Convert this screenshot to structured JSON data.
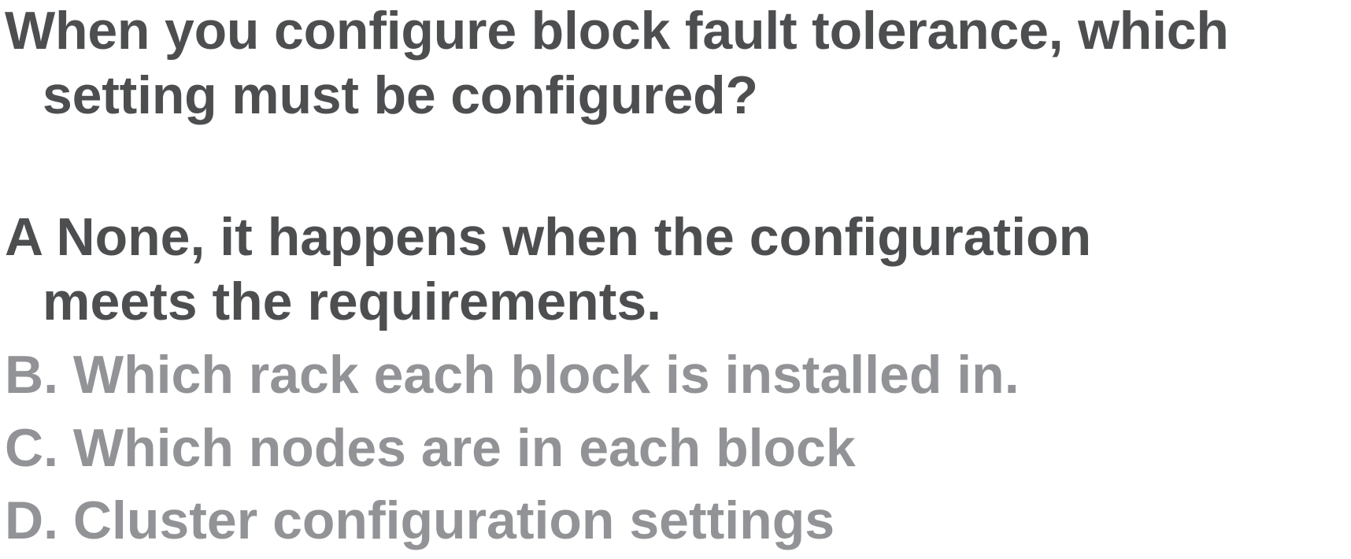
{
  "question": {
    "line1": "When you configure block fault tolerance, which",
    "line2": "setting must be configured?"
  },
  "options": [
    {
      "line1": "A None, it happens when the configuration",
      "line2": "meets the requirements."
    },
    {
      "line1": "B. Which rack each block is installed in."
    },
    {
      "line1": "C. Which nodes are in each block"
    },
    {
      "line1": "D. Cluster configuration settings"
    }
  ],
  "colors": {
    "primary_text": "#4d4e50",
    "muted_text": "#929396",
    "background": "#ffffff"
  }
}
